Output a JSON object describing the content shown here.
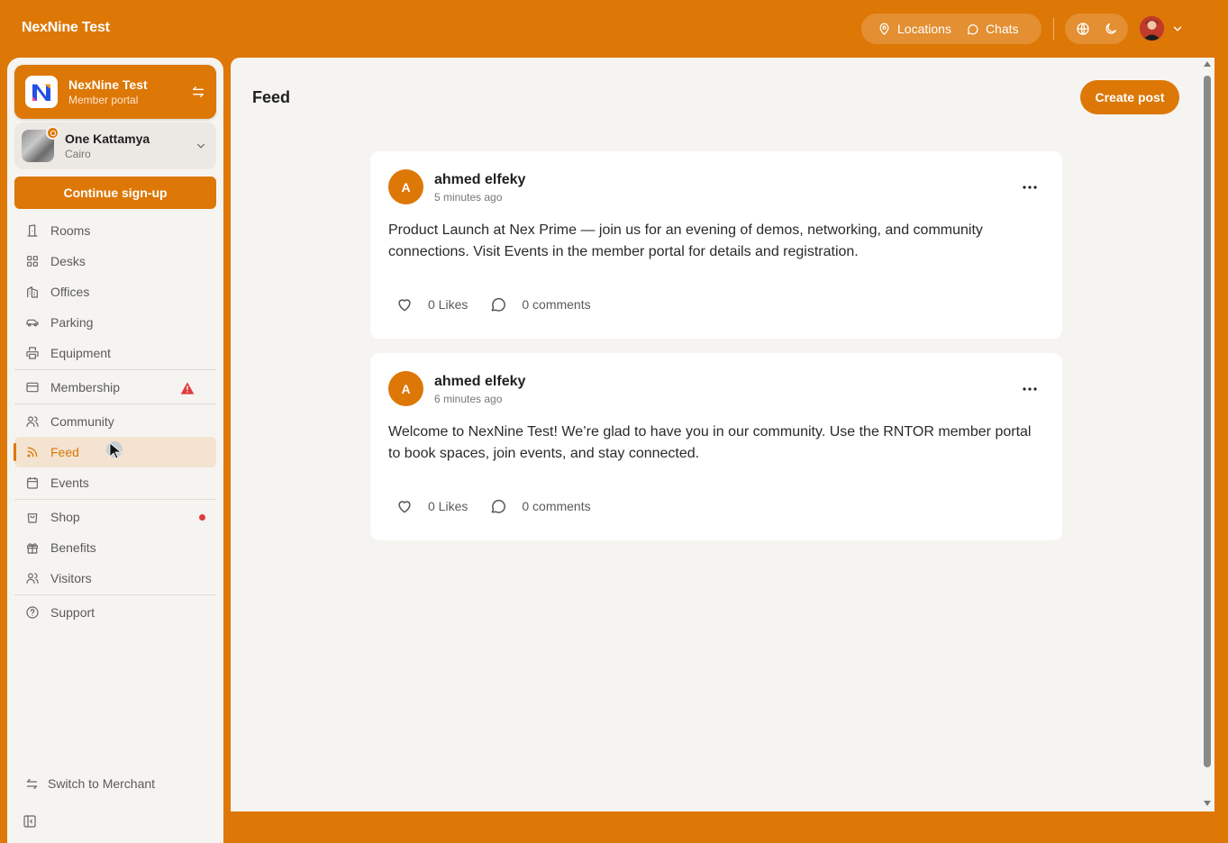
{
  "app": {
    "brand": "NexNine Test",
    "accent_color": "#dd7706"
  },
  "topbar": {
    "locations_label": "Locations",
    "chats_label": "Chats",
    "icons": [
      "map-pin-icon",
      "chat-icon",
      "globe-icon",
      "moon-icon",
      "chevron-down-icon"
    ]
  },
  "sidebar": {
    "org": {
      "name": "NexNine Test",
      "subtitle": "Member portal"
    },
    "location": {
      "name": "One Kattamya",
      "city": "Cairo"
    },
    "signup_label": "Continue sign-up",
    "items": [
      {
        "label": "Rooms",
        "icon": "door-icon"
      },
      {
        "label": "Desks",
        "icon": "grid-icon"
      },
      {
        "label": "Offices",
        "icon": "building-icon"
      },
      {
        "label": "Parking",
        "icon": "car-icon"
      },
      {
        "label": "Equipment",
        "icon": "printer-icon"
      },
      {
        "label": "Membership",
        "icon": "card-icon",
        "alert": true
      },
      {
        "label": "Community",
        "icon": "users-icon"
      },
      {
        "label": "Feed",
        "icon": "rss-icon",
        "active": true
      },
      {
        "label": "Events",
        "icon": "calendar-icon"
      },
      {
        "label": "Shop",
        "icon": "shopping-bag-icon",
        "dot": true
      },
      {
        "label": "Benefits",
        "icon": "gift-icon"
      },
      {
        "label": "Visitors",
        "icon": "users-icon"
      },
      {
        "label": "Support",
        "icon": "help-circle-icon"
      }
    ],
    "switch_label": "Switch to Merchant"
  },
  "main": {
    "title": "Feed",
    "create_label": "Create post",
    "posts": [
      {
        "initial": "A",
        "author": "ahmed elfeky",
        "time": "5 minutes ago",
        "body": "Product Launch at Nex Prime — join us for an evening of demos, networking, and community connections. Visit Events in the member portal for details and registration.",
        "likes": "0 Likes",
        "comments": "0 comments"
      },
      {
        "initial": "A",
        "author": "ahmed elfeky",
        "time": "6 minutes ago",
        "body": "Welcome to NexNine Test! We’re glad to have you in our community. Use the RNTOR member portal to book spaces, join events, and stay connected.",
        "likes": "0 Likes",
        "comments": "0 comments"
      }
    ]
  }
}
